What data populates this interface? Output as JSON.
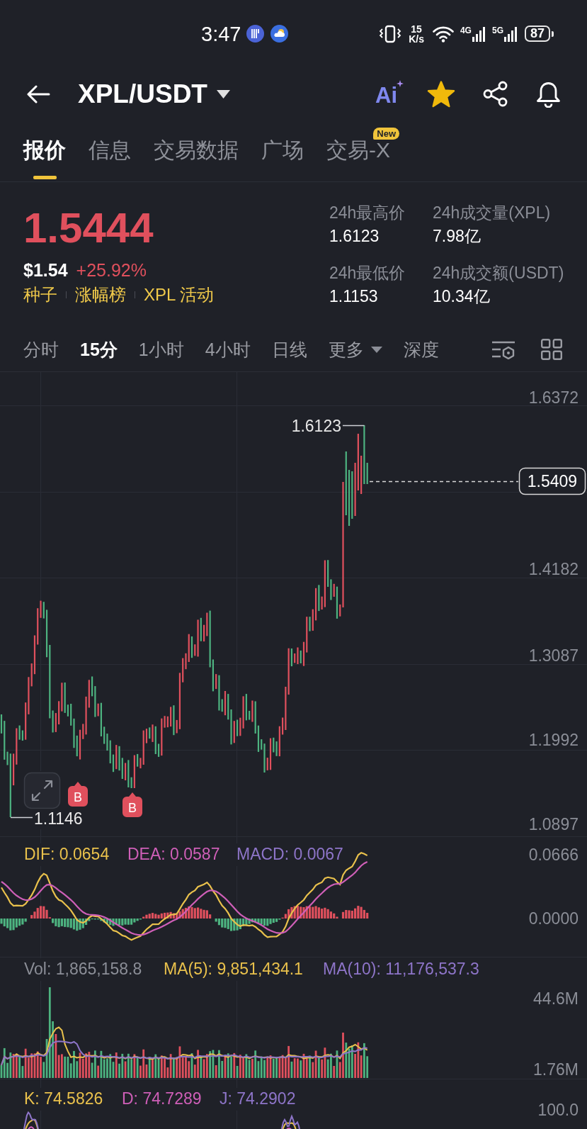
{
  "status_bar": {
    "time": "3:47",
    "network_speed": {
      "value": "15",
      "unit": "K/s"
    },
    "networks": [
      {
        "label": "4G"
      },
      {
        "label": "5G"
      }
    ],
    "battery": "87"
  },
  "header": {
    "pair": "XPL/USDT",
    "ai_label": "Ai",
    "favorite": true
  },
  "tabs": [
    {
      "label": "报价",
      "selected": true
    },
    {
      "label": "信息",
      "selected": false
    },
    {
      "label": "交易数据",
      "selected": false
    },
    {
      "label": "广场",
      "selected": false
    },
    {
      "label": "交易-X",
      "selected": false,
      "badge": "New"
    }
  ],
  "ticker": {
    "last_price": "1.5444",
    "rising": true,
    "usd_price": "$1.54",
    "change": "+25.92%",
    "tags": [
      "种子",
      "涨幅榜",
      "XPL 活动"
    ],
    "stats": [
      {
        "label": "24h最高价",
        "value": "1.6123"
      },
      {
        "label": "24h最低价",
        "value": "1.1153"
      },
      {
        "label": "24h成交量(XPL)",
        "value": "7.98亿"
      },
      {
        "label": "24h成交额(USDT)",
        "value": "10.34亿"
      }
    ]
  },
  "intervals": [
    {
      "label": "分时",
      "selected": false,
      "kind": "option"
    },
    {
      "label": "15分",
      "selected": true,
      "kind": "option"
    },
    {
      "label": "1小时",
      "selected": false,
      "kind": "option"
    },
    {
      "label": "4小时",
      "selected": false,
      "kind": "option"
    },
    {
      "label": "日线",
      "selected": false,
      "kind": "option"
    },
    {
      "label": "更多",
      "selected": false,
      "kind": "dropdown"
    },
    {
      "label": "深度",
      "selected": false,
      "kind": "option"
    }
  ],
  "price_chart": {
    "axis_labels": [
      "1.6372",
      "1.4182",
      "1.3087",
      "1.1992",
      "1.0897"
    ],
    "high_label": "1.6123",
    "low_label": "1.1146",
    "last_price": "1.5409",
    "trade_markers": [
      "B",
      "B"
    ]
  },
  "macd": {
    "legend": [
      {
        "text": "DIF: 0.0654",
        "color": "#e9c14c"
      },
      {
        "text": "DEA: 0.0587",
        "color": "#cf5fb8"
      },
      {
        "text": "MACD: 0.0067",
        "color": "#8e75c9"
      }
    ],
    "axis_labels": [
      "0.0666",
      "0.0000"
    ]
  },
  "volume": {
    "legend": [
      {
        "text": "Vol: 1,865,158.8",
        "color": "#8b8e97"
      },
      {
        "text": "MA(5): 9,851,434.1",
        "color": "#e9c14c"
      },
      {
        "text": "MA(10): 11,176,537.3",
        "color": "#8e75c9"
      }
    ],
    "axis_labels": [
      "44.6M",
      "1.76M"
    ]
  },
  "kdj": {
    "legend": [
      {
        "text": "K: 74.5826",
        "color": "#e9c14c"
      },
      {
        "text": "D: 74.7289",
        "color": "#cf5fb8"
      },
      {
        "text": "J: 74.2902",
        "color": "#8e75c9"
      }
    ],
    "axis_labels": [
      "100.0"
    ]
  }
}
